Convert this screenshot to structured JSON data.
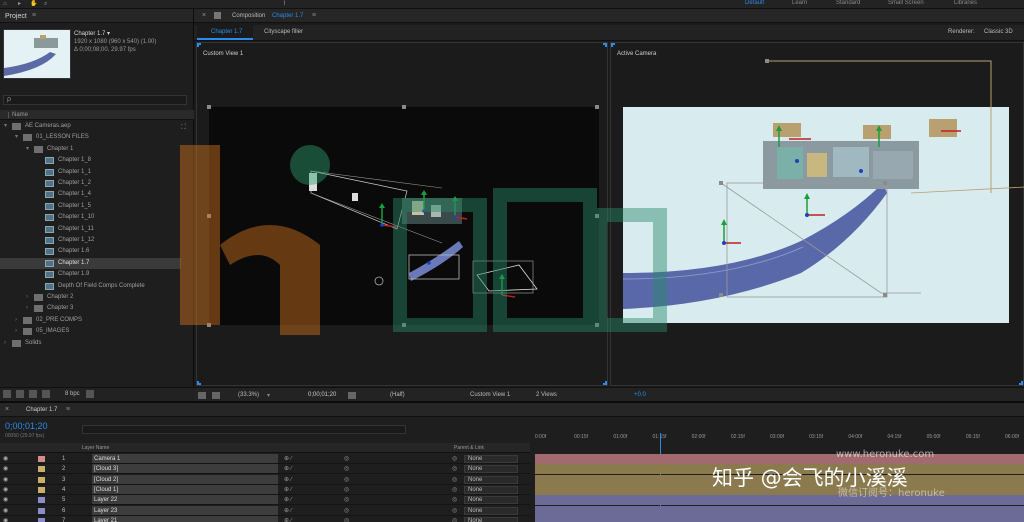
{
  "workspaces": [
    {
      "label": "Default",
      "active": true
    },
    {
      "label": "Learn",
      "active": false
    },
    {
      "label": "Standard",
      "active": false
    },
    {
      "label": "Small Screen",
      "active": false
    },
    {
      "label": "Libraries",
      "active": false
    }
  ],
  "project": {
    "panel_title": "Project",
    "comp_name": "Chapter 1.7 ▾",
    "comp_size": "1920 x 1080 (960 x 540) (1.00)",
    "comp_duration": "Δ 0;00;08;00, 29.97 fps",
    "search_placeholder": "ρ",
    "column_name": "Name",
    "bpc": "8 bpc",
    "tree": [
      {
        "label": "AE Cameras.aep",
        "kind": "file",
        "indent": 0,
        "twist": "▾"
      },
      {
        "label": "01_LESSON FILES",
        "kind": "folder",
        "indent": 1,
        "twist": "▾"
      },
      {
        "label": "Chapter 1",
        "kind": "folder",
        "indent": 2,
        "twist": "▾"
      },
      {
        "label": "Chapter 1_8",
        "kind": "comp",
        "indent": 3,
        "twist": ""
      },
      {
        "label": "Chapter 1_1",
        "kind": "comp",
        "indent": 3,
        "twist": ""
      },
      {
        "label": "Chapter 1_2",
        "kind": "comp",
        "indent": 3,
        "twist": ""
      },
      {
        "label": "Chapter 1_4",
        "kind": "comp",
        "indent": 3,
        "twist": ""
      },
      {
        "label": "Chapter 1_5",
        "kind": "comp",
        "indent": 3,
        "twist": ""
      },
      {
        "label": "Chapter 1_10",
        "kind": "comp",
        "indent": 3,
        "twist": ""
      },
      {
        "label": "Chapter 1_11",
        "kind": "comp",
        "indent": 3,
        "twist": ""
      },
      {
        "label": "Chapter 1_12",
        "kind": "comp",
        "indent": 3,
        "twist": ""
      },
      {
        "label": "Chapter 1.6",
        "kind": "comp",
        "indent": 3,
        "twist": ""
      },
      {
        "label": "Chapter 1.7",
        "kind": "comp",
        "indent": 3,
        "twist": "",
        "selected": true
      },
      {
        "label": "Chapter 1.9",
        "kind": "comp",
        "indent": 3,
        "twist": ""
      },
      {
        "label": "Depth Of Field Comps Complete",
        "kind": "comp",
        "indent": 3,
        "twist": ""
      },
      {
        "label": "Chapter 2",
        "kind": "folder",
        "indent": 2,
        "twist": "›"
      },
      {
        "label": "Chapter 3",
        "kind": "folder",
        "indent": 2,
        "twist": "›"
      },
      {
        "label": "02_PRE COMPS",
        "kind": "folder",
        "indent": 1,
        "twist": "›"
      },
      {
        "label": "05_IMAGES",
        "kind": "folder",
        "indent": 1,
        "twist": "›"
      },
      {
        "label": "Solids",
        "kind": "folder",
        "indent": 0,
        "twist": "›"
      }
    ]
  },
  "composition": {
    "panel_label": "Composition",
    "panel_comp": "Chapter 1.7",
    "tab_active": "Chapter 1.7",
    "tab_other": "Cityscape filler",
    "renderer_label": "Renderer:",
    "renderer_value": "Classic 3D",
    "view_left_label": "Custom View 1",
    "view_right_label": "Active Camera",
    "footer": {
      "zoom": "(33.3%)",
      "timecode": "0;00;01;20",
      "resolution": "(Half)",
      "view": "Custom View 1",
      "views": "2 Views",
      "exposure": "+0.0"
    }
  },
  "timeline": {
    "tab_label": "Chapter 1.7",
    "current_time": "0;00;01;20",
    "current_time_sub": "00050 (29.97 fps)",
    "col_layer_name": "Layer Name",
    "col_parent": "Parent & Link",
    "ruler": [
      "0:00f",
      "00:15f",
      "01:00f",
      "01:15f",
      "02:00f",
      "02:15f",
      "03:00f",
      "03:15f",
      "04:00f",
      "04:15f",
      "05:00f",
      "05:15f",
      "06:00f"
    ],
    "playhead_fraction": 0.258,
    "layers": [
      {
        "num": "1",
        "name": "Camera 1",
        "parent": "None",
        "label_color": "#d28c8c",
        "bar_color": "#a06a6e"
      },
      {
        "num": "2",
        "name": "[Cloud 3]",
        "parent": "None",
        "label_color": "#c8b06c",
        "bar_color": "#8a7a4e"
      },
      {
        "num": "3",
        "name": "[Cloud 2]",
        "parent": "None",
        "label_color": "#c8b06c",
        "bar_color": "#8a7a4e"
      },
      {
        "num": "4",
        "name": "[Cloud 1]",
        "parent": "None",
        "label_color": "#c8b06c",
        "bar_color": "#8a7a4e"
      },
      {
        "num": "5",
        "name": "Layer 22",
        "parent": "None",
        "label_color": "#8c8cc8",
        "bar_color": "#6c6a96"
      },
      {
        "num": "6",
        "name": "Layer 23",
        "parent": "None",
        "label_color": "#8c8cc8",
        "bar_color": "#6c6a96"
      },
      {
        "num": "7",
        "name": "Layer 21",
        "parent": "None",
        "label_color": "#8c8cc8",
        "bar_color": "#6c6a96"
      }
    ]
  },
  "watermarks": {
    "zhihu": "知乎 @会飞的小溪溪",
    "site": "www.heronuke.com",
    "wechat": "微信订阅号：heronuke"
  }
}
